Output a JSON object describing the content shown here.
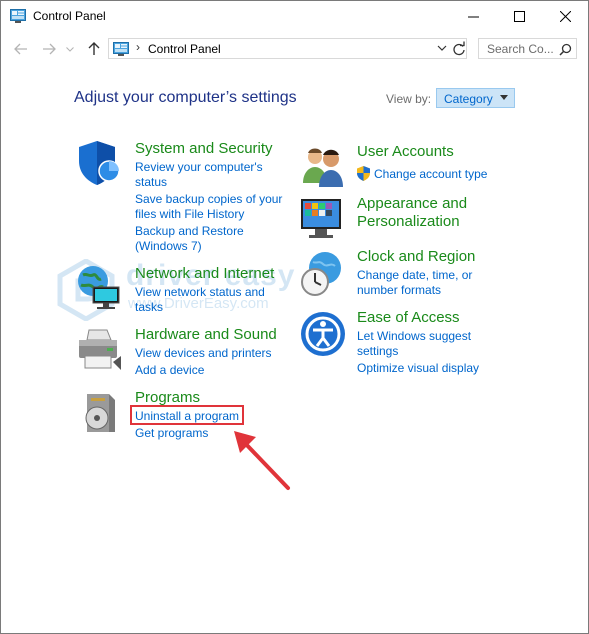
{
  "window": {
    "title": "Control Panel"
  },
  "address": {
    "breadcrumb": "Control Panel"
  },
  "search": {
    "placeholder": "Search Co..."
  },
  "main": {
    "heading": "Adjust your computer’s settings",
    "view_by_label": "View by:",
    "view_by_value": "Category"
  },
  "categories": {
    "system_security": {
      "title": "System and Security",
      "links": [
        "Review your computer's status",
        "Save backup copies of your files with File History",
        "Backup and Restore (Windows 7)"
      ]
    },
    "network": {
      "title": "Network and Internet",
      "links": [
        "View network status and tasks"
      ]
    },
    "hardware": {
      "title": "Hardware and Sound",
      "links": [
        "View devices and printers",
        "Add a device"
      ]
    },
    "programs": {
      "title": "Programs",
      "links": [
        "Uninstall a program",
        "Get programs"
      ]
    },
    "user_accounts": {
      "title": "User Accounts",
      "links": [
        "Change account type"
      ]
    },
    "appearance": {
      "title": "Appearance and Personalization"
    },
    "clock": {
      "title": "Clock and Region",
      "links": [
        "Change date, time, or number formats"
      ]
    },
    "ease": {
      "title": "Ease of Access",
      "links": [
        "Let Windows suggest settings",
        "Optimize visual display"
      ]
    }
  },
  "watermark": {
    "brand": "driver easy",
    "url": "www.DriverEasy.com"
  },
  "colors": {
    "heading": "#1e3287",
    "category_title": "#1a8a1a",
    "link": "#0066cc",
    "highlight": "#e0343a"
  }
}
